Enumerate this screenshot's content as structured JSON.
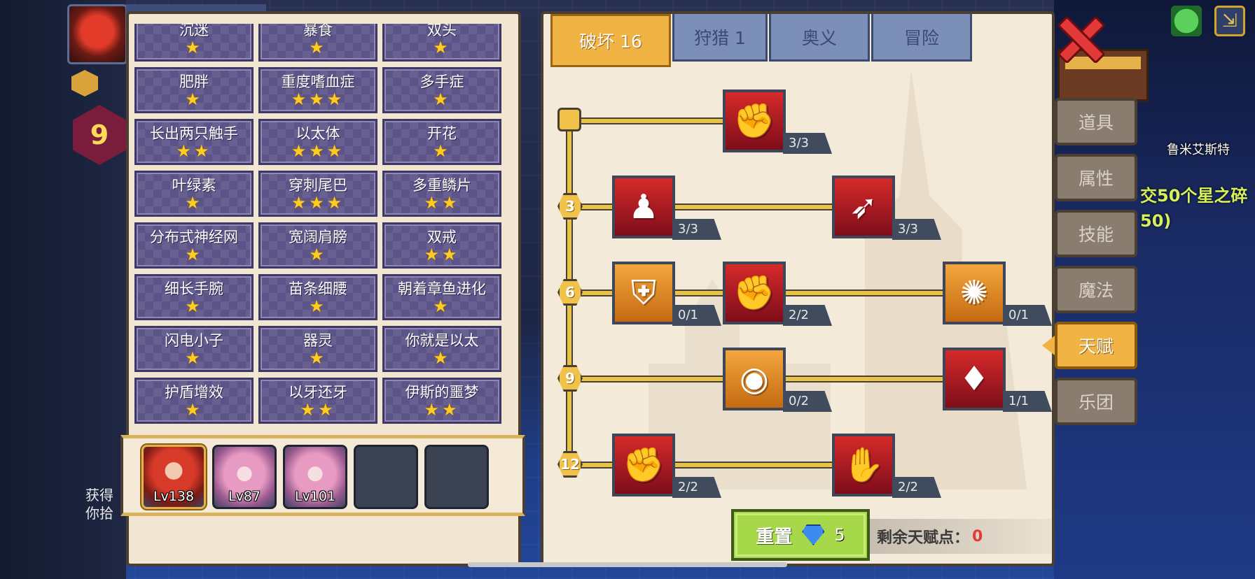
{
  "background": {
    "pickup_message": [
      "获得",
      "你拾"
    ],
    "city_label": "鲁米艾斯特",
    "quest_text": [
      "交50个星之碎",
      "50)"
    ],
    "hud_level": "9"
  },
  "traits": [
    {
      "name": "沉迷",
      "stars": "★"
    },
    {
      "name": "暴食",
      "stars": "★"
    },
    {
      "name": "双头",
      "stars": "★"
    },
    {
      "name": "肥胖",
      "stars": "★"
    },
    {
      "name": "重度嗜血症",
      "stars": "★★★"
    },
    {
      "name": "多手症",
      "stars": "★"
    },
    {
      "name": "长出两只触手",
      "stars": "★★"
    },
    {
      "name": "以太体",
      "stars": "★★★"
    },
    {
      "name": "开花",
      "stars": "★"
    },
    {
      "name": "叶绿素",
      "stars": "★"
    },
    {
      "name": "穿刺尾巴",
      "stars": "★★★"
    },
    {
      "name": "多重鳞片",
      "stars": "★★"
    },
    {
      "name": "分布式神经网",
      "stars": "★"
    },
    {
      "name": "宽阔肩膀",
      "stars": "★"
    },
    {
      "name": "双戒",
      "stars": "★★"
    },
    {
      "name": "细长手腕",
      "stars": "★"
    },
    {
      "name": "苗条细腰",
      "stars": "★"
    },
    {
      "name": "朝着章鱼进化",
      "stars": "★"
    },
    {
      "name": "闪电小子",
      "stars": "★"
    },
    {
      "name": "器灵",
      "stars": "★"
    },
    {
      "name": "你就是以太",
      "stars": "★"
    },
    {
      "name": "护盾增效",
      "stars": "★"
    },
    {
      "name": "以牙还牙",
      "stars": "★★"
    },
    {
      "name": "伊斯的噩梦",
      "stars": "★★"
    }
  ],
  "party": [
    {
      "level": "Lv138",
      "portrait": "red-hair-girl"
    },
    {
      "level": "Lv87",
      "portrait": "pink-hair-girl"
    },
    {
      "level": "Lv101",
      "portrait": "pink-hair-girl"
    },
    {
      "level": "",
      "portrait": "empty"
    },
    {
      "level": "",
      "portrait": "empty"
    }
  ],
  "tabs": [
    {
      "label": "破坏 16",
      "active": true
    },
    {
      "label": "狩猎 1",
      "active": false
    },
    {
      "label": "奥义",
      "active": false
    },
    {
      "label": "冒险",
      "active": false
    }
  ],
  "tiers": [
    "3",
    "6",
    "9",
    "12"
  ],
  "skills": [
    {
      "icon": "arm-wrestle-icon",
      "count": "3/3"
    },
    {
      "icon": "muscle-body-icon",
      "count": "3/3"
    },
    {
      "icon": "arrow-slash-icon",
      "count": "3/3"
    },
    {
      "icon": "shield-break-icon",
      "count": "0/1"
    },
    {
      "icon": "punch-icon",
      "count": "2/2"
    },
    {
      "icon": "blood-splash-icon",
      "count": "0/1"
    },
    {
      "icon": "ripple-orb-icon",
      "count": "0/2"
    },
    {
      "icon": "bat-wing-icon",
      "count": "1/1"
    },
    {
      "icon": "fist-icon",
      "count": "2/2"
    },
    {
      "icon": "open-palm-icon",
      "count": "2/2"
    }
  ],
  "reset": {
    "label": "重置",
    "gem_cost": "5"
  },
  "remaining": {
    "label": "剩余天赋点：",
    "value": "0"
  },
  "side_menu": [
    {
      "label": "道具",
      "active": false
    },
    {
      "label": "属性",
      "active": false
    },
    {
      "label": "技能",
      "active": false
    },
    {
      "label": "魔法",
      "active": false
    },
    {
      "label": "天赋",
      "active": true
    },
    {
      "label": "乐团",
      "active": false
    }
  ],
  "colors": {
    "accent": "#f0b344",
    "trait_cell": "#5c5488",
    "skill_red": "#b51c25",
    "skill_orange": "#e48a26",
    "remain_value": "#e23a3a"
  }
}
